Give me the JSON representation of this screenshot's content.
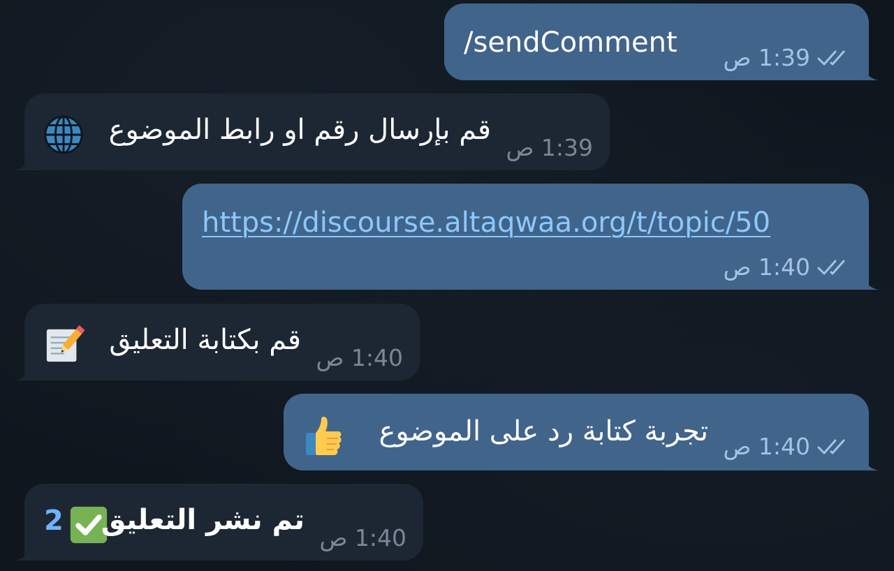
{
  "messages": [
    {
      "direction": "outgoing",
      "text": "/sendComment",
      "time": "1:39 ص",
      "status_icon": "double-check-icon"
    },
    {
      "direction": "incoming",
      "text": "قم بإرسال رقم او رابط الموضوع",
      "emoji": "globe-icon",
      "time": "1:39 ص"
    },
    {
      "direction": "outgoing",
      "text": "https://discourse.altaqwaa.org/t/topic/50",
      "time": "1:40 ص",
      "status_icon": "double-check-icon"
    },
    {
      "direction": "incoming",
      "text": "قم بكتابة التعليق",
      "emoji": "memo-icon",
      "time": "1:40 ص"
    },
    {
      "direction": "outgoing",
      "text": "تجربة كتابة رد على الموضوع",
      "emoji": "thumbs-up-icon",
      "time": "1:40 ص",
      "status_icon": "double-check-icon"
    },
    {
      "direction": "incoming",
      "text": "تم نشر التعليق",
      "emoji": "check-mark-button-icon",
      "count": "2",
      "time": "1:40 ص"
    }
  ],
  "colors": {
    "background": "#0f161e",
    "outgoing_bubble": "#41648b",
    "incoming_bubble": "#1d2733",
    "link": "#8cc8ff",
    "outgoing_meta": "#a4c4e6",
    "incoming_meta": "#7b8794"
  }
}
